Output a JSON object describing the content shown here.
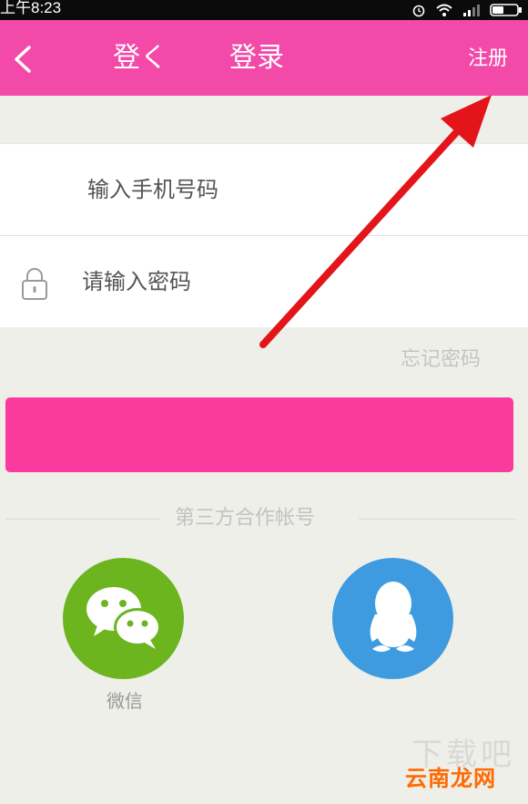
{
  "status_bar": {
    "time": "上午8:23",
    "icons": [
      "alarm-icon",
      "wifi-icon",
      "signal-icon",
      "battery-icon"
    ]
  },
  "header": {
    "background": "#f349a8",
    "back_icon": "chevron-left-icon",
    "ghost_title": "登く",
    "title": "登录",
    "register_label": "注册"
  },
  "form": {
    "phone_placeholder": "输入手机号码",
    "password_placeholder": "请输入密码",
    "password_icon": "lock-icon",
    "forgot_label": "忘记密码",
    "login_button_color": "#fa3a9c"
  },
  "third_party": {
    "divider_text": "第三方合作帐号",
    "wechat_label": "微信",
    "wechat_color": "#6cb51f",
    "qq_color": "#3e9be0",
    "icons": [
      "wechat-icon",
      "qq-icon"
    ]
  },
  "annotation": {
    "arrow_color": "#e3151b"
  },
  "watermark": {
    "text": "云南龙网",
    "ghost_text": "下载吧"
  }
}
